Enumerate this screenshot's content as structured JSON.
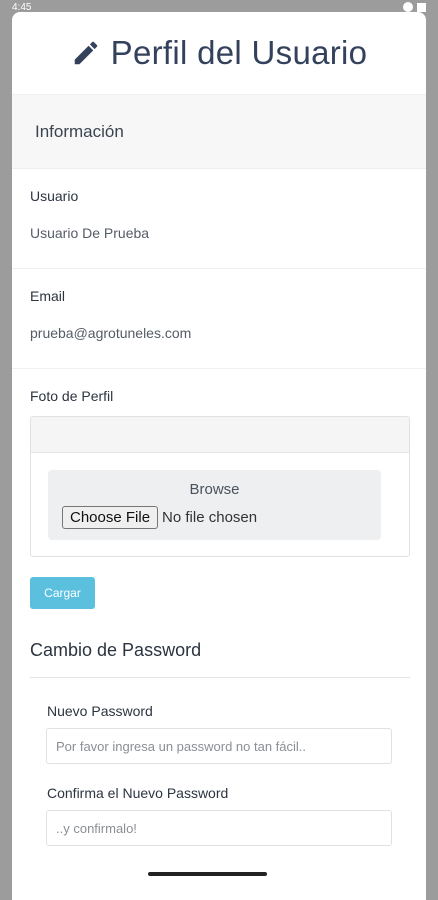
{
  "status_bar": {
    "time": "4:45"
  },
  "header": {
    "title": "Perfil del Usuario",
    "icon": "pencil-icon"
  },
  "info_card": {
    "title": "Información"
  },
  "usuario": {
    "label": "Usuario",
    "value": "Usuario De Prueba"
  },
  "email": {
    "label": "Email",
    "value": "prueba@agrotuneles.com"
  },
  "foto": {
    "label": "Foto de Perfil",
    "browse_label": "Browse",
    "choose_button": "Choose File",
    "no_file_text": "No file chosen"
  },
  "cargar": {
    "label": "Cargar"
  },
  "password": {
    "title": "Cambio de Password",
    "new_label": "Nuevo Password",
    "new_placeholder": "Por favor ingresa un password no tan fácil..",
    "confirm_label": "Confirma el Nuevo Password",
    "confirm_placeholder": "..y confirmalo!"
  },
  "colors": {
    "accent": "#5bc0de",
    "title": "#33415c"
  }
}
